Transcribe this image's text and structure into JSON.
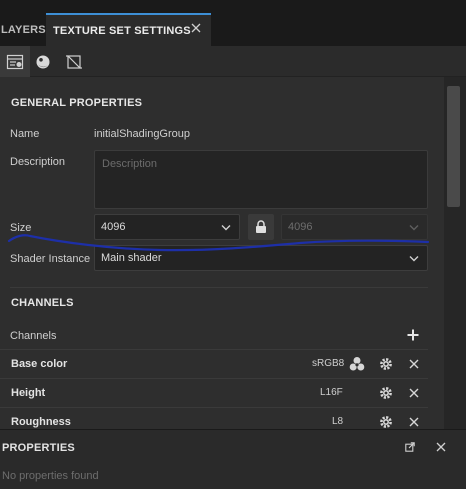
{
  "tabs": {
    "layers": "LAYERS",
    "texture_set_settings": "TEXTURE SET SETTINGS"
  },
  "toolbar": {
    "icons": [
      "texture-set-list-icon",
      "material-sphere-icon",
      "uv-crop-icon"
    ]
  },
  "general": {
    "title": "GENERAL PROPERTIES",
    "name_label": "Name",
    "name_value": "initialShadingGroup",
    "description_label": "Description",
    "description_placeholder": "Description",
    "size_label": "Size",
    "size_value": "4096",
    "size_linked_value": "4096",
    "shader_label": "Shader Instance",
    "shader_value": "Main shader"
  },
  "channels": {
    "title": "CHANNELS",
    "list_label": "Channels",
    "items": [
      {
        "name": "Base color",
        "format": "sRGB8"
      },
      {
        "name": "Height",
        "format": "L16F"
      },
      {
        "name": "Roughness",
        "format": "L8"
      }
    ]
  },
  "properties": {
    "title": "PROPERTIES",
    "empty_text": "No properties found"
  },
  "colors": {
    "accent": "#3d8fd6",
    "annotation_pen": "#1d2fa8"
  }
}
